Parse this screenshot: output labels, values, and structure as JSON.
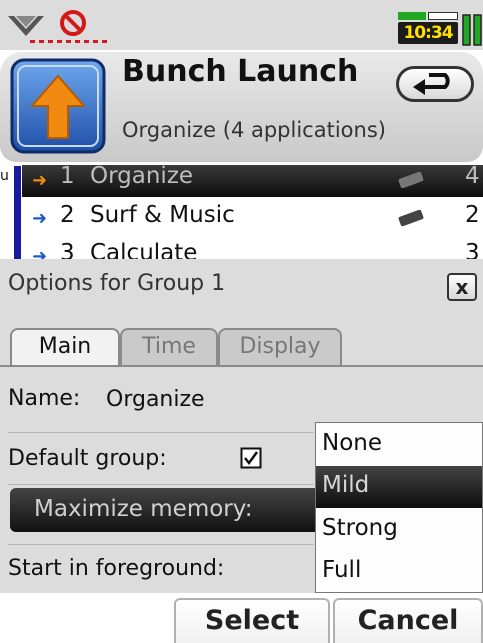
{
  "status": {
    "time": "10:34"
  },
  "header": {
    "title": "Bunch Launch",
    "subtitle": "Organize (4 applications)"
  },
  "background_list": {
    "left_letter": "u",
    "rows": [
      {
        "index": "1",
        "name": "Organize",
        "count": "4"
      },
      {
        "index": "2",
        "name": "Surf & Music",
        "count": "2"
      },
      {
        "index": "3",
        "name": "Calculate",
        "count": "3"
      }
    ]
  },
  "dialog": {
    "title": "Options for Group 1",
    "close_label": "x",
    "tabs": [
      "Main",
      "Time",
      "Display"
    ],
    "name_label": "Name:",
    "name_value": "Organize",
    "default_group_label": "Default group:",
    "default_group_checked": true,
    "maximize_memory_label": "Maximize memory:",
    "start_foreground_label": "Start in foreground:"
  },
  "dropdown": {
    "options": [
      "None",
      "Mild",
      "Strong",
      "Full"
    ],
    "selected": "Mild"
  },
  "softkeys": {
    "left": "Select",
    "right": "Cancel"
  },
  "colors": {
    "selection_dark": "#111111",
    "accent_blue": "#1a1aa0",
    "arrow_orange": "#f08a10"
  }
}
